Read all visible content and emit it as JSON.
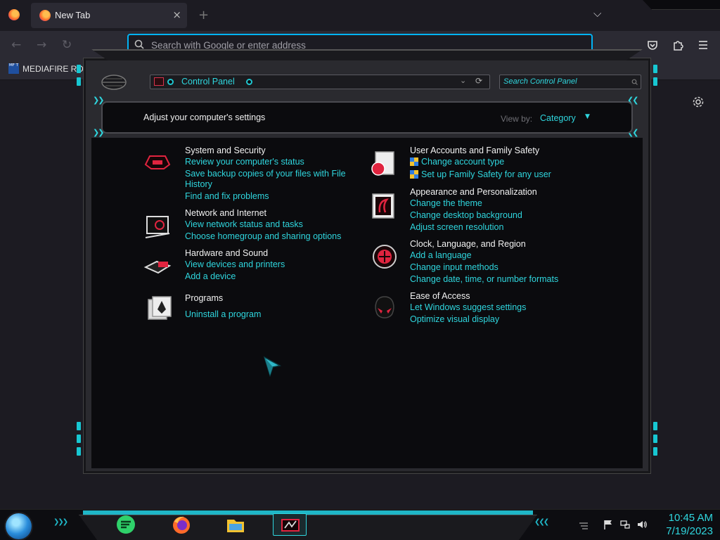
{
  "browser": {
    "tab_title": "New Tab",
    "tab_close": "×",
    "new_tab": "+",
    "list_tabs": "⌵",
    "back": "←",
    "forward": "→",
    "reload": "↻",
    "url_placeholder": "Search with Google or enter address",
    "bookmark_label": "MEDIAFIRE RO",
    "bookmark_icon_text": "MF T"
  },
  "control_panel": {
    "address": "Control Panel",
    "address_dropdown": "⌄",
    "refresh": "⟳",
    "search_placeholder": "Search Control Panel",
    "heading": "Adjust your computer's settings",
    "view_by_label": "View by:",
    "view_by_value": "Category",
    "view_by_chevron": "▼",
    "left_chevrons": "❯❯",
    "right_chevrons": "❮❮",
    "categories": [
      {
        "title": "System and Security",
        "links": [
          "Review your computer's status",
          "Save backup copies of your files with File",
          "History",
          "Find and fix problems"
        ]
      },
      {
        "title": "Network and Internet",
        "links": [
          "View network status and tasks",
          "Choose homegroup and sharing options"
        ]
      },
      {
        "title": "Hardware and Sound",
        "links": [
          "View devices and printers",
          "Add a device"
        ]
      },
      {
        "title": "Programs",
        "links": [
          "Uninstall a program"
        ]
      },
      {
        "title": "User Accounts and Family Safety",
        "links": [
          "Change account type",
          "Set up Family Safety for any user"
        ]
      },
      {
        "title": "Appearance and Personalization",
        "links": [
          "Change the theme",
          "Change desktop background",
          "Adjust screen resolution"
        ]
      },
      {
        "title": "Clock, Language, and Region",
        "links": [
          "Add a language",
          "Change input methods",
          "Change date, time, or number formats"
        ]
      },
      {
        "title": "Ease of Access",
        "links": [
          "Let Windows suggest settings",
          "Optimize visual display"
        ]
      }
    ]
  },
  "taskbar": {
    "time": "10:45 AM",
    "date": "7/19/2023",
    "chevrons": "❯❯❯",
    "chevrons_left": "❮❮❮"
  },
  "colors": {
    "accent": "#2fd6de",
    "firefox_focus": "#00b3f4",
    "icon_red": "#e0243f"
  }
}
